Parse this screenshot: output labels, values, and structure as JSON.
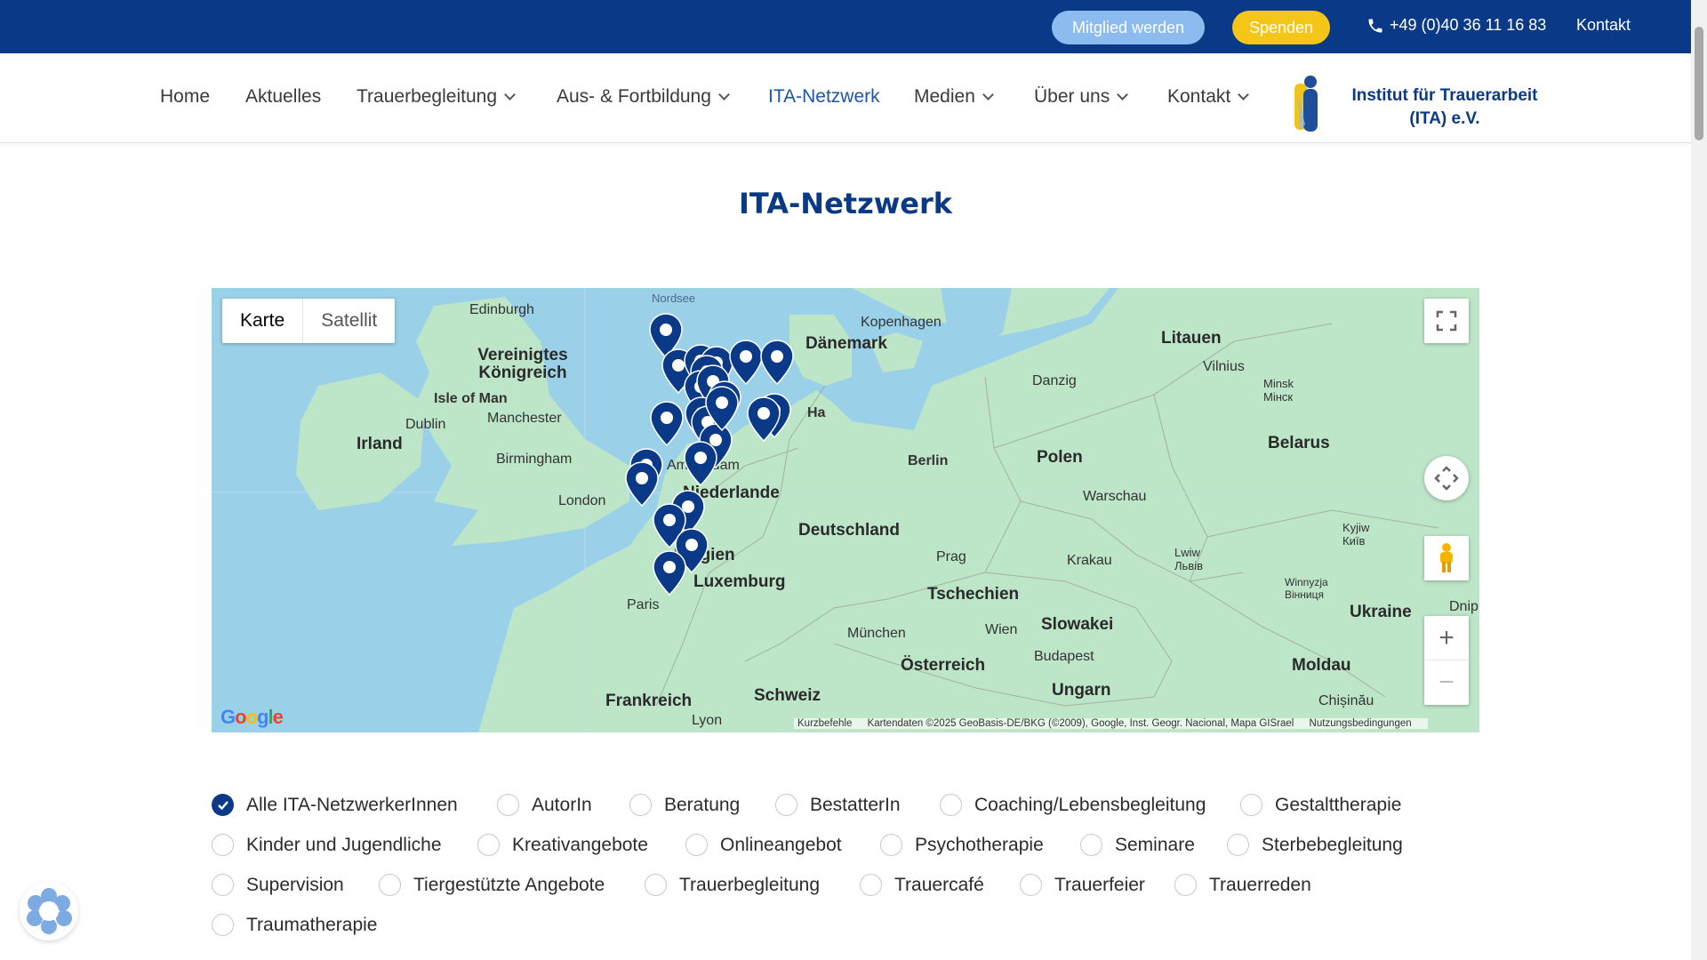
{
  "topbar": {
    "member_label": "Mitglied werden",
    "donate_label": "Spenden",
    "phone": "+49 (0)40 36 11 16 83",
    "contact_label": "Kontakt"
  },
  "nav": {
    "items": [
      {
        "label": "Home"
      },
      {
        "label": "Aktuelles"
      },
      {
        "label": "Trauerbegleitung"
      },
      {
        "label": "Aus- & Fortbildung"
      },
      {
        "label": "ITA-Netzwerk"
      },
      {
        "label": "Medien"
      },
      {
        "label": "Über uns"
      },
      {
        "label": "Kontakt"
      }
    ],
    "active": "ITA-Netzwerk",
    "logo_line1": "Institut für Trauerarbeit",
    "logo_line2": "(ITA) e.V."
  },
  "page": {
    "title": "ITA-Netzwerk"
  },
  "map": {
    "type_buttons": [
      "Karte",
      "Satellit"
    ],
    "selected_type": "Karte",
    "labels": {
      "nordsee": "Nordsee",
      "edinburgh": "Edinburgh",
      "uk": "Vereinigtes Königreich",
      "isle_of_man": "Isle of Man",
      "dublin": "Dublin",
      "irland": "Irland",
      "manchester": "Manchester",
      "birmingham": "Birmingham",
      "london": "London",
      "amsterdam": "Amsterdam",
      "niederlande": "Niederlande",
      "belgien": "Belgien",
      "luxemburg": "Luxemburg",
      "paris": "Paris",
      "frankreich": "Frankreich",
      "lyon": "Lyon",
      "schweiz": "Schweiz",
      "daenemark": "Dänemark",
      "kopenhagen": "Kopenhagen",
      "deutschland": "Deutschland",
      "hamburg": "Ha",
      "berlin": "Berlin",
      "muenchen": "München",
      "prag": "Prag",
      "tschechien": "Tschechien",
      "wien": "Wien",
      "oesterreich": "Österreich",
      "budapest": "Budapest",
      "ungarn": "Ungarn",
      "slowakei": "Slowakei",
      "krakau": "Krakau",
      "polen": "Polen",
      "warschau": "Warschau",
      "danzig": "Danzig",
      "litauen": "Litauen",
      "vilnius": "Vilnius",
      "minsk": "Minsk\nМінск",
      "belarus": "Belarus",
      "lwiw": "Lwiw\nЛьвів",
      "kyjiw": "Kyjiw\nКиїв",
      "winnyzja": "Winnyzja\nВінниця",
      "ukraine": "Ukraine",
      "moldau": "Moldau",
      "chisinau": "Chișinău",
      "dnip": "Dnip"
    },
    "google": "Google",
    "attribution": {
      "shortcuts": "Kurzbefehle",
      "data": "Kartendaten ©2025 GeoBasis-DE/BKG (©2009), Google, Inst. Geogr. Nacional, Mapa GISrael",
      "terms": "Nutzungsbedingungen"
    },
    "marker_color": "#0a3a87"
  },
  "filters": [
    {
      "label": "Alle ITA-NetzwerkerInnen",
      "checked": true
    },
    {
      "label": "AutorIn",
      "checked": false
    },
    {
      "label": "Beratung",
      "checked": false
    },
    {
      "label": "BestatterIn",
      "checked": false
    },
    {
      "label": "Coaching/Lebensbegleitung",
      "checked": false
    },
    {
      "label": "Gestalttherapie",
      "checked": false
    },
    {
      "label": "Kinder und Jugendliche",
      "checked": false
    },
    {
      "label": "Kreativangebote",
      "checked": false
    },
    {
      "label": "Onlineangebot",
      "checked": false
    },
    {
      "label": "Psychotherapie",
      "checked": false
    },
    {
      "label": "Seminare",
      "checked": false
    },
    {
      "label": "Sterbebegleitung",
      "checked": false
    },
    {
      "label": "Supervision",
      "checked": false
    },
    {
      "label": "Tiergestützte Angebote",
      "checked": false
    },
    {
      "label": "Trauerbegleitung",
      "checked": false
    },
    {
      "label": "Trauercafé",
      "checked": false
    },
    {
      "label": "Trauerfeier",
      "checked": false
    },
    {
      "label": "Trauerreden",
      "checked": false
    },
    {
      "label": "Traumatherapie",
      "checked": false
    }
  ],
  "colors": {
    "brand": "#0a3a87",
    "accent_yellow": "#f5c518",
    "member_blue": "#8cbbef"
  }
}
